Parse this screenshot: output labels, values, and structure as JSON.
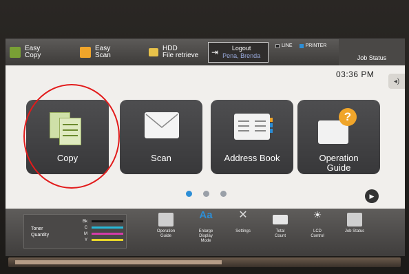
{
  "topbar": {
    "easy_copy": "Easy\nCopy",
    "easy_scan": "Easy\nScan",
    "hdd_line1": "HDD",
    "hdd_line2": "File retrieve",
    "logout_label": "Logout",
    "logout_user": "Pena, Brenda",
    "line_label": "LINE",
    "printer_label": "PRINTER",
    "job_status": "Job Status"
  },
  "clock": {
    "time": "03:36 PM"
  },
  "tiles": [
    {
      "label": "Copy"
    },
    {
      "label": "Scan"
    },
    {
      "label": "Address Book"
    },
    {
      "label": "Operation Guide"
    }
  ],
  "pagination": {
    "pages": 3,
    "current": 1
  },
  "toner": {
    "label_line1": "Toner",
    "label_line2": "Quantity",
    "rows": [
      {
        "key": "Bk",
        "color": "#111111"
      },
      {
        "key": "C",
        "color": "#27b9d8"
      },
      {
        "key": "M",
        "color": "#d43ba8"
      },
      {
        "key": "Y",
        "color": "#e8d62a"
      }
    ]
  },
  "bottombar": {
    "items": [
      {
        "label": "Operation\nGuide",
        "icon": "operation-guide-icon"
      },
      {
        "label": "Enlarge\nDisplay\nMode",
        "icon": "enlarge-display-icon"
      },
      {
        "label": "Settings",
        "icon": "settings-icon"
      },
      {
        "label": "Total\nCount",
        "icon": "total-count-icon"
      },
      {
        "label": "LCD\nControl",
        "icon": "lcd-control-icon"
      },
      {
        "label": "Job Status",
        "icon": "job-status-icon"
      }
    ]
  },
  "colors": {
    "accent": "#2d8ed6",
    "tile": "#444446",
    "annotation": "#e21b1b",
    "easy_icon": "#f0a52a"
  }
}
